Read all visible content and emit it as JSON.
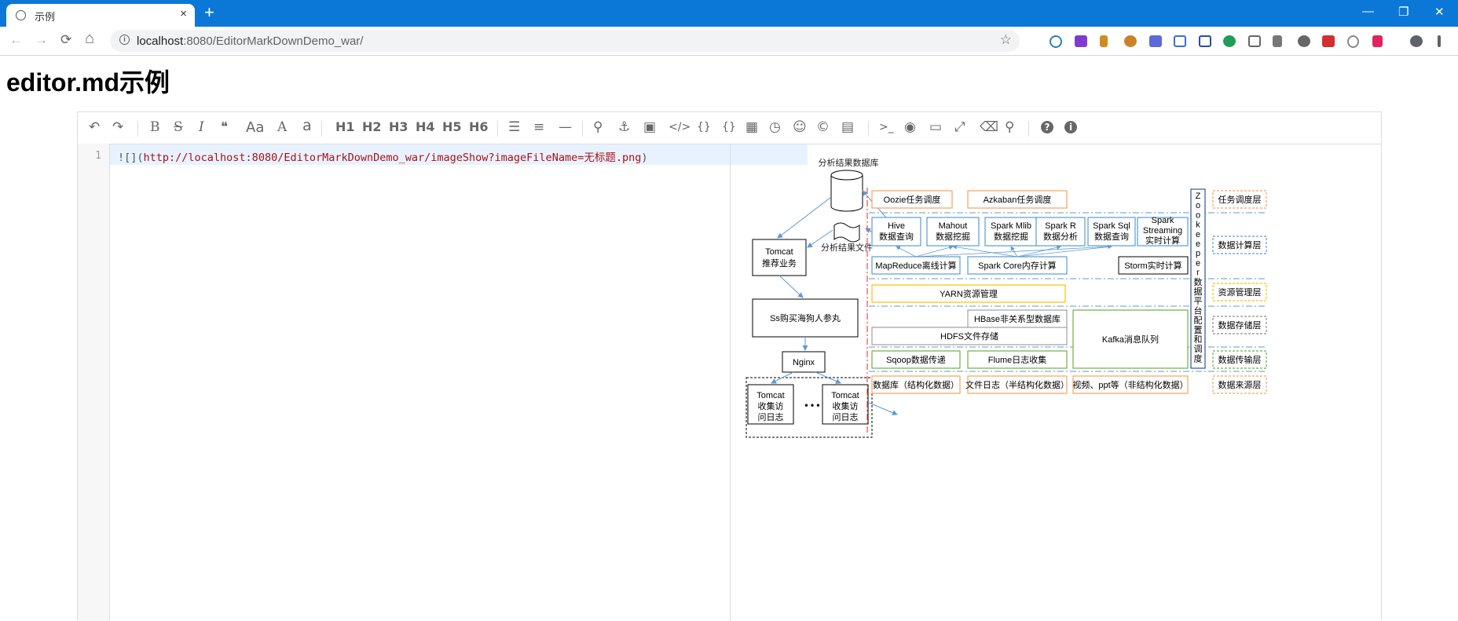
{
  "browser": {
    "tab_title": "示例",
    "tab_close": "×",
    "new_tab": "+",
    "url_host": "localhost",
    "url_rest": ":8080/EditorMarkDownDemo_war/",
    "back": "←",
    "forward": "→",
    "reload": "⟳",
    "home": "⌂",
    "bookmark": "☆",
    "window_controls": {
      "minimize": "—",
      "restore": "❐",
      "close": "✕"
    }
  },
  "page": {
    "title": "editor.md示例"
  },
  "toolbar": {
    "undo": "↶",
    "redo": "↷",
    "bold": "B",
    "strike": "S",
    "italic": "I",
    "quote": "❝",
    "ucfirst": "Aa",
    "ucwords": "A",
    "lowercase": "a",
    "h1": "H1",
    "h2": "H2",
    "h3": "H3",
    "h4": "H4",
    "h5": "H5",
    "h6": "H6",
    "list_ul": "☰",
    "list_ol": "≡",
    "hr": "—",
    "link": "⚲",
    "anchor": "⚓",
    "image": "▣",
    "code": "</>",
    "code_block": "{}",
    "pre": "{}",
    "table": "▦",
    "datetime": "◷",
    "emoji": "☺",
    "html_entities": "©",
    "pagebreak": "▤",
    "goto_line": ">_",
    "watch": "◉",
    "preview": "▭",
    "fullscreen": "⤢",
    "clear": "⌫",
    "search": "⚲",
    "help": "?",
    "info": "i"
  },
  "editor": {
    "line_number": "1",
    "code_prefix": "![](",
    "code_url": "http://localhost:8080/EditorMarkDownDemo_war/imageShow?imageFileName=无标题.png",
    "code_suffix": ")"
  },
  "diagram": {
    "db_label": "分析结果数据库",
    "file_label": "分析结果文件",
    "tomcat_rec_line1": "Tomcat",
    "tomcat_rec_line2": "推荐业务",
    "ss_label": "Ss购买海狗人参丸",
    "nginx": "Nginx",
    "tomcat_a_line1": "Tomcat",
    "tomcat_a_line2": "收集访",
    "tomcat_a_line3": "问日志",
    "tomcat_b_line1": "Tomcat",
    "tomcat_b_line2": "收集访",
    "tomcat_b_line3": "问日志",
    "dots": "• • •",
    "oozie": "Oozie任务调度",
    "azkaban": "Azkaban任务调度",
    "hive_line1": "Hive",
    "hive_line2": "数据查询",
    "mahout_line1": "Mahout",
    "mahout_line2": "数据挖掘",
    "mlib_line1": "Spark Mlib",
    "mlib_line2": "数据挖掘",
    "sparkr_line1": "Spark R",
    "sparkr_line2": "数据分析",
    "sparksql_line1": "Spark Sql",
    "sparksql_line2": "数据查询",
    "streaming_line1": "Spark",
    "streaming_line2": "Streaming",
    "streaming_line3": "实时计算",
    "mapreduce": "MapReduce离线计算",
    "sparkcore": "Spark Core内存计算",
    "storm": "Storm实时计算",
    "yarn": "YARN资源管理",
    "hbase": "HBase非关系型数据库",
    "hdfs": "HDFS文件存储",
    "kafka": "Kafka消息队列",
    "sqoop": "Sqoop数据传递",
    "flume": "Flume日志收集",
    "src_db": "数据库（结构化数据）",
    "src_file": "文件日志（半结构化数据）",
    "src_video": "视频、ppt等（非结构化数据）",
    "zk_letters": [
      "Z",
      "o",
      "o",
      "k",
      "e",
      "e",
      "p",
      "e",
      "r"
    ],
    "zk_cn": [
      "数",
      "据",
      "平",
      "台",
      "配",
      "置",
      "和",
      "调",
      "度"
    ],
    "layer_task": "任务调度层",
    "layer_compute": "数据计算层",
    "layer_resource": "资源管理层",
    "layer_storage": "数据存储层",
    "layer_transfer": "数据传输层",
    "layer_source": "数据来源层"
  },
  "colors": {
    "chrome_blue": "#0b78d7",
    "orange": "#f5a35b",
    "blue": "#5b9bd5",
    "yellow": "#ffc000",
    "gray": "#8c8c8c",
    "green": "#70ad47",
    "red_dash": "#e84c4c"
  }
}
